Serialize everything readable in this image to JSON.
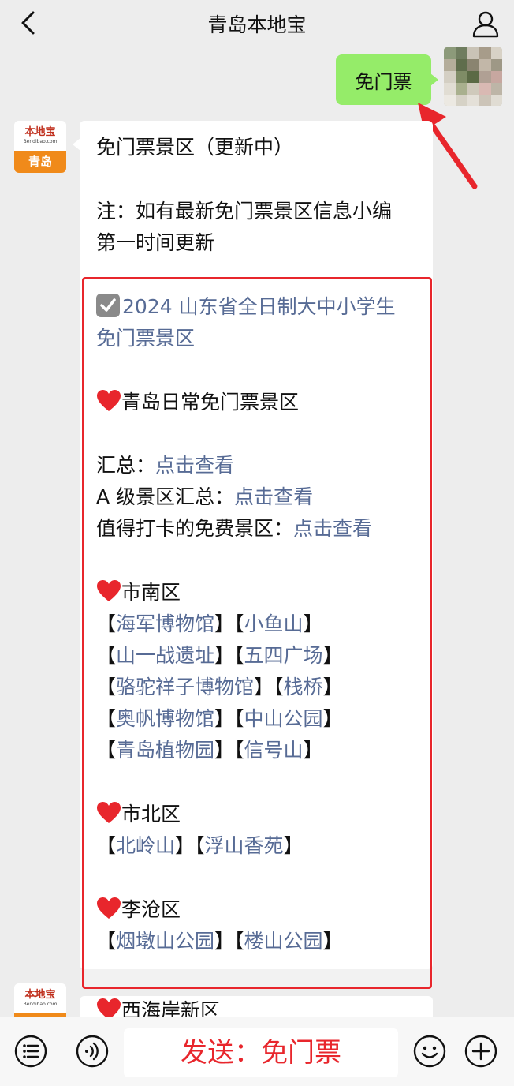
{
  "header": {
    "title": "青岛本地宝"
  },
  "outgoing": {
    "text": "免门票"
  },
  "bot": {
    "avatar_name": "本地宝",
    "avatar_url": "Bendibao.com",
    "avatar_city": "青岛"
  },
  "message": {
    "title": "免门票景区（更新中）",
    "note_line1": "注：如有最新免门票景区信息小编",
    "note_line2": "第一时间更新",
    "student_line1": "2024 山东省全日制大中小学生",
    "student_line2": "免门票景区",
    "daily_heading": "青岛日常免门票景区",
    "summary_rows": [
      {
        "label": "汇总：",
        "link": "点击查看"
      },
      {
        "label": "A 级景区汇总：",
        "link": "点击查看"
      },
      {
        "label": "值得打卡的免费景区：",
        "link": "点击查看"
      }
    ],
    "districts": [
      {
        "name": "市南区",
        "rows": [
          [
            "海军博物馆",
            "小鱼山"
          ],
          [
            "山一战遗址",
            "五四广场"
          ],
          [
            "骆驼祥子博物馆",
            "栈桥"
          ],
          [
            "奥帆博物馆",
            "中山公园"
          ],
          [
            "青岛植物园",
            "信号山"
          ]
        ]
      },
      {
        "name": "市北区",
        "rows": [
          [
            "北岭山",
            "浮山香苑"
          ]
        ]
      },
      {
        "name": "李沧区",
        "rows": [
          [
            "烟墩山公园",
            "楼山公园"
          ]
        ]
      }
    ],
    "next_district": "西海岸新区"
  },
  "input": {
    "text": "发送：免门票"
  },
  "colors": {
    "link": "#576b95",
    "highlight": "#e8262c",
    "bubble_out": "#95ec69"
  }
}
